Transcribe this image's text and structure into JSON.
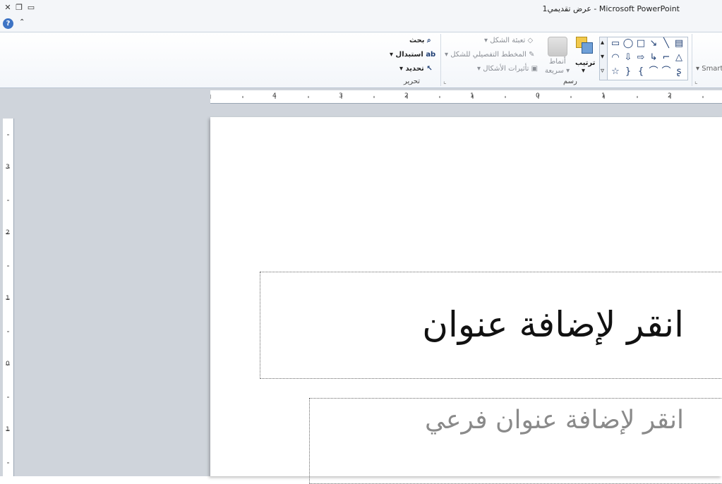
{
  "window": {
    "title": "عرض تقديمي1 - Microsoft PowerPoint"
  },
  "window_controls": {
    "close": "✕",
    "restore": "❐",
    "minimize": "▭"
  },
  "helprow": {
    "help": "?",
    "collapse": "⌃"
  },
  "ribbon": {
    "editing": {
      "label": "تحرير",
      "find": "بحث",
      "replace": "استبدال",
      "select": "تحديد"
    },
    "drawing": {
      "label": "رسم",
      "shape_fill": "تعبئة الشكل",
      "shape_outline": "المخطط التفصيلي للشكل",
      "shape_effects": "تأثيرات الأشكال",
      "quick_styles_line1": "أنماط",
      "quick_styles_line2": "سريعة",
      "arrange": "ترتيب"
    },
    "smartart_partial": "Smart"
  },
  "ruler": {
    "h_numbers": [
      "4",
      "3",
      "2",
      "1",
      "0",
      "1",
      "2"
    ],
    "v_numbers": [
      "3",
      "2",
      "1",
      "0",
      "1"
    ]
  },
  "slide": {
    "title_placeholder": "انقر لإضافة عنوان",
    "subtitle_placeholder": "انقر لإضافة عنوان فرعي"
  },
  "colors": {
    "accent": "#3d73c4",
    "shape_icon": "#1e3e73",
    "workspace": "#cfd4db"
  }
}
